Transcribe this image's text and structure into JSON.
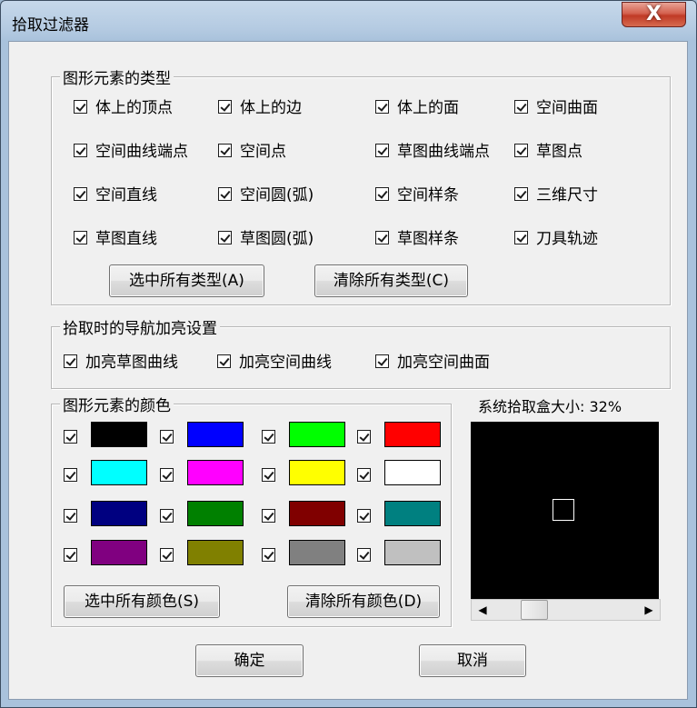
{
  "window": {
    "title": "拾取过滤器",
    "close_label": "X"
  },
  "types_group": {
    "title": "图形元素的类型",
    "items": [
      {
        "label": "体上的顶点"
      },
      {
        "label": "体上的边"
      },
      {
        "label": "体上的面"
      },
      {
        "label": "空间曲面"
      },
      {
        "label": "空间曲线端点"
      },
      {
        "label": "空间点"
      },
      {
        "label": "草图曲线端点"
      },
      {
        "label": "草图点"
      },
      {
        "label": "空间直线"
      },
      {
        "label": "空间圆(弧)"
      },
      {
        "label": "空间样条"
      },
      {
        "label": "三维尺寸"
      },
      {
        "label": "草图直线"
      },
      {
        "label": "草图圆(弧)"
      },
      {
        "label": "草图样条"
      },
      {
        "label": "刀具轨迹"
      }
    ],
    "select_all": "选中所有类型(A)",
    "clear_all": "清除所有类型(C)"
  },
  "nav_group": {
    "title": "拾取时的导航加亮设置",
    "items": [
      {
        "label": "加亮草图曲线"
      },
      {
        "label": "加亮空间曲线"
      },
      {
        "label": "加亮空间曲面"
      }
    ]
  },
  "colors_group": {
    "title": "图形元素的颜色",
    "swatches": [
      "#000000",
      "#0000ff",
      "#00ff00",
      "#ff0000",
      "#00ffff",
      "#ff00ff",
      "#ffff00",
      "#ffffff",
      "#000080",
      "#008000",
      "#800000",
      "#008080",
      "#800080",
      "#808000",
      "#808080",
      "#c0c0c0"
    ],
    "select_all": "选中所有颜色(S)",
    "clear_all": "清除所有颜色(D)"
  },
  "pickbox": {
    "label": "系统拾取盒大小:",
    "value": "32%",
    "level_fraction": 0.32
  },
  "footer": {
    "ok": "确定",
    "cancel": "取消"
  }
}
